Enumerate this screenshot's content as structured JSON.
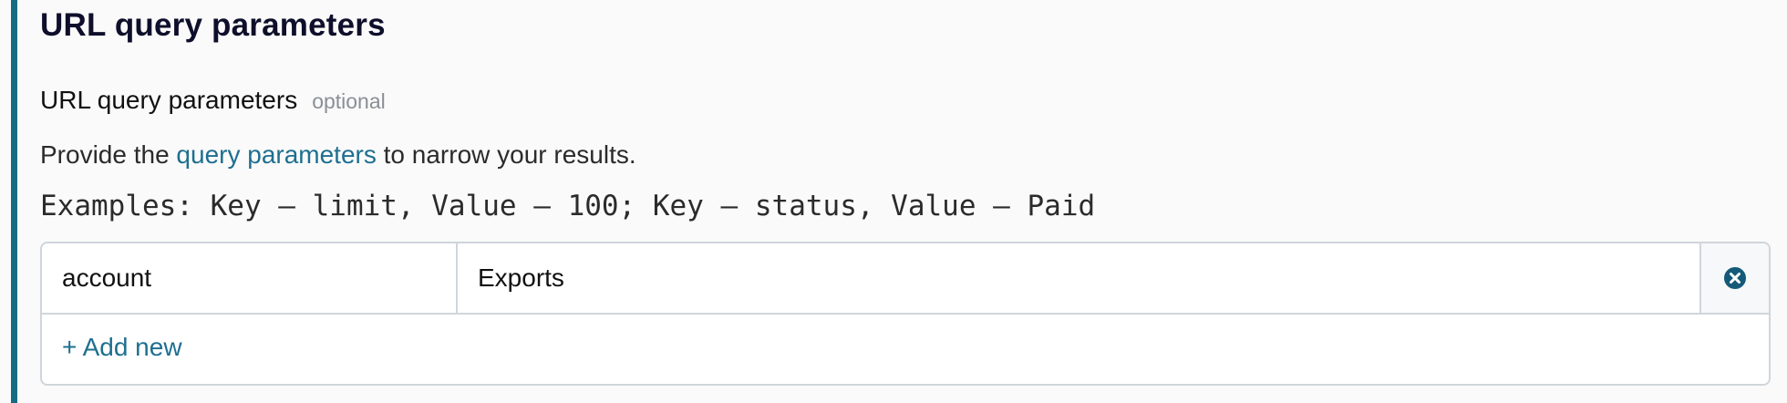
{
  "section": {
    "title": "URL query parameters"
  },
  "field": {
    "label": "URL query parameters",
    "optional_tag": "optional",
    "help_prefix": "Provide the ",
    "help_link": "query parameters",
    "help_suffix": " to narrow your results.",
    "examples": "Examples: Key – limit, Value – 100; Key – status, Value – Paid"
  },
  "params": [
    {
      "key": "account",
      "value": "Exports"
    }
  ],
  "actions": {
    "remove_icon": "close-circle-icon",
    "add_new_label": "+ Add new"
  },
  "colors": {
    "accent": "#146c84",
    "link": "#1e6f8f",
    "icon": "#145a78"
  }
}
